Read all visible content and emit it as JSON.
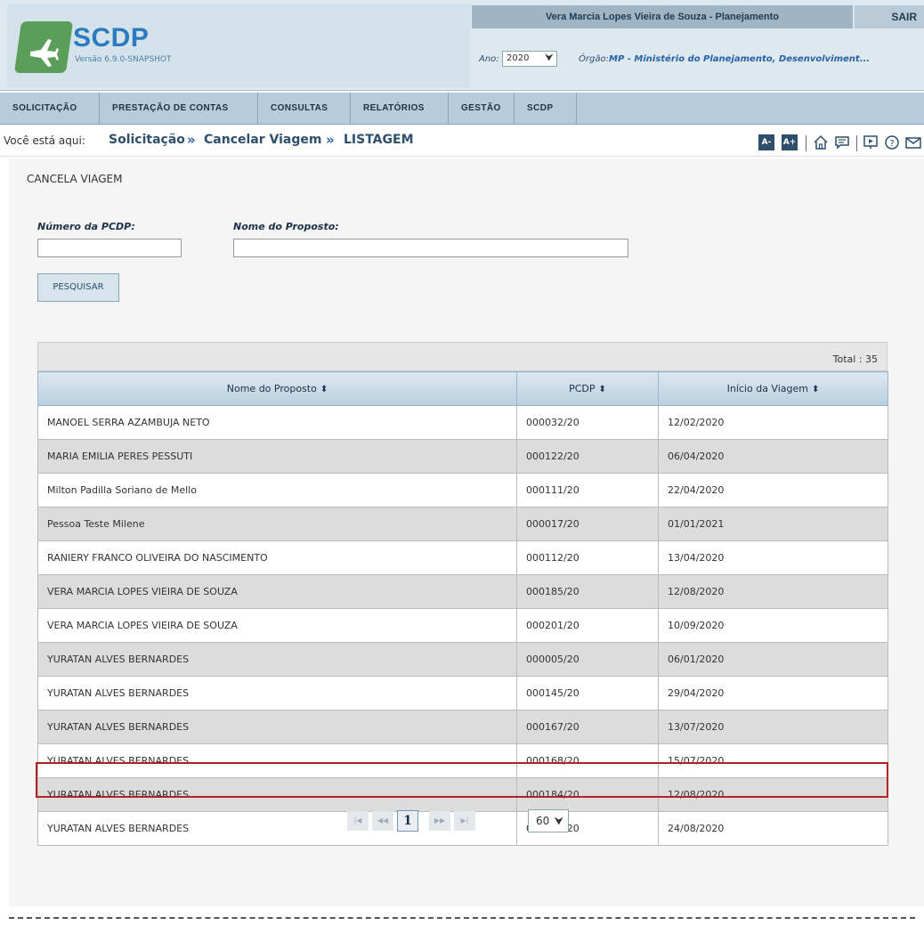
{
  "header": {
    "app_name": "SCDP",
    "version": "Versão 6.9.0-SNAPSHOT",
    "user_info": "Vera Marcia Lopes Vieira de Souza - Planejamento",
    "logout": "SAIR",
    "year_label": "Ano:",
    "year_value": "2020",
    "org_label": "Órgão:",
    "org_value": "MP - Ministério do Planejamento, Desenvolviment..."
  },
  "nav": {
    "items": [
      "SOLICITAÇÃO",
      "PRESTAÇÃO DE CONTAS",
      "CONSULTAS",
      "RELATÓRIOS",
      "GESTÃO",
      "SCDP"
    ]
  },
  "breadcrumb": {
    "prefix": "Você está aqui:",
    "items": [
      "Solicitação",
      "Cancelar Viagem",
      "LISTAGEM"
    ],
    "font_decrease": "A-",
    "font_increase": "A+"
  },
  "page": {
    "title": "CANCELA VIAGEM",
    "pcdp_label": "Número da PCDP:",
    "name_label": "Nome do Proposto:",
    "search_button": "PESQUISAR"
  },
  "table": {
    "total": "Total : 35",
    "columns": [
      "Nome do Proposto",
      "PCDP",
      "Início da Viagem"
    ],
    "rows": [
      [
        "MANOEL SERRA AZAMBUJA NETO",
        "000032/20",
        "12/02/2020"
      ],
      [
        "MARIA EMILIA PERES PESSUTI",
        "000122/20",
        "06/04/2020"
      ],
      [
        "Milton Padilla Soriano de Mello",
        "000111/20",
        "22/04/2020"
      ],
      [
        "Pessoa Teste Milene",
        "000017/20",
        "01/01/2021"
      ],
      [
        "RANIERY FRANCO OLIVEIRA DO NASCIMENTO",
        "000112/20",
        "13/04/2020"
      ],
      [
        "VERA MARCIA LOPES VIEIRA DE SOUZA",
        "000185/20",
        "12/08/2020"
      ],
      [
        "VERA MARCIA LOPES VIEIRA DE SOUZA",
        "000201/20",
        "10/09/2020"
      ],
      [
        "YURATAN ALVES BERNARDES",
        "000005/20",
        "06/01/2020"
      ],
      [
        "YURATAN ALVES BERNARDES",
        "000145/20",
        "29/04/2020"
      ],
      [
        "YURATAN ALVES BERNARDES",
        "000167/20",
        "13/07/2020"
      ],
      [
        "YURATAN ALVES BERNARDES",
        "000168/20",
        "15/07/2020"
      ],
      [
        "YURATAN ALVES BERNARDES",
        "000184/20",
        "12/08/2020"
      ],
      [
        "YURATAN ALVES BERNARDES",
        "000189/20",
        "24/08/2020"
      ]
    ]
  },
  "pagination": {
    "current_page": "1",
    "page_size": "60"
  },
  "colors": {
    "accent": "#2d4f6c",
    "highlight_border": "#b22222",
    "logo_green": "#5a9e5a",
    "logo_blue": "#2c7bbf"
  },
  "icons": [
    "plane-icon",
    "home-icon",
    "chat-icon",
    "presentation-icon",
    "help-icon",
    "mail-icon",
    "sort-icon",
    "chevron-down-icon",
    "first-page-icon",
    "prev-page-icon",
    "next-page-icon",
    "last-page-icon"
  ]
}
